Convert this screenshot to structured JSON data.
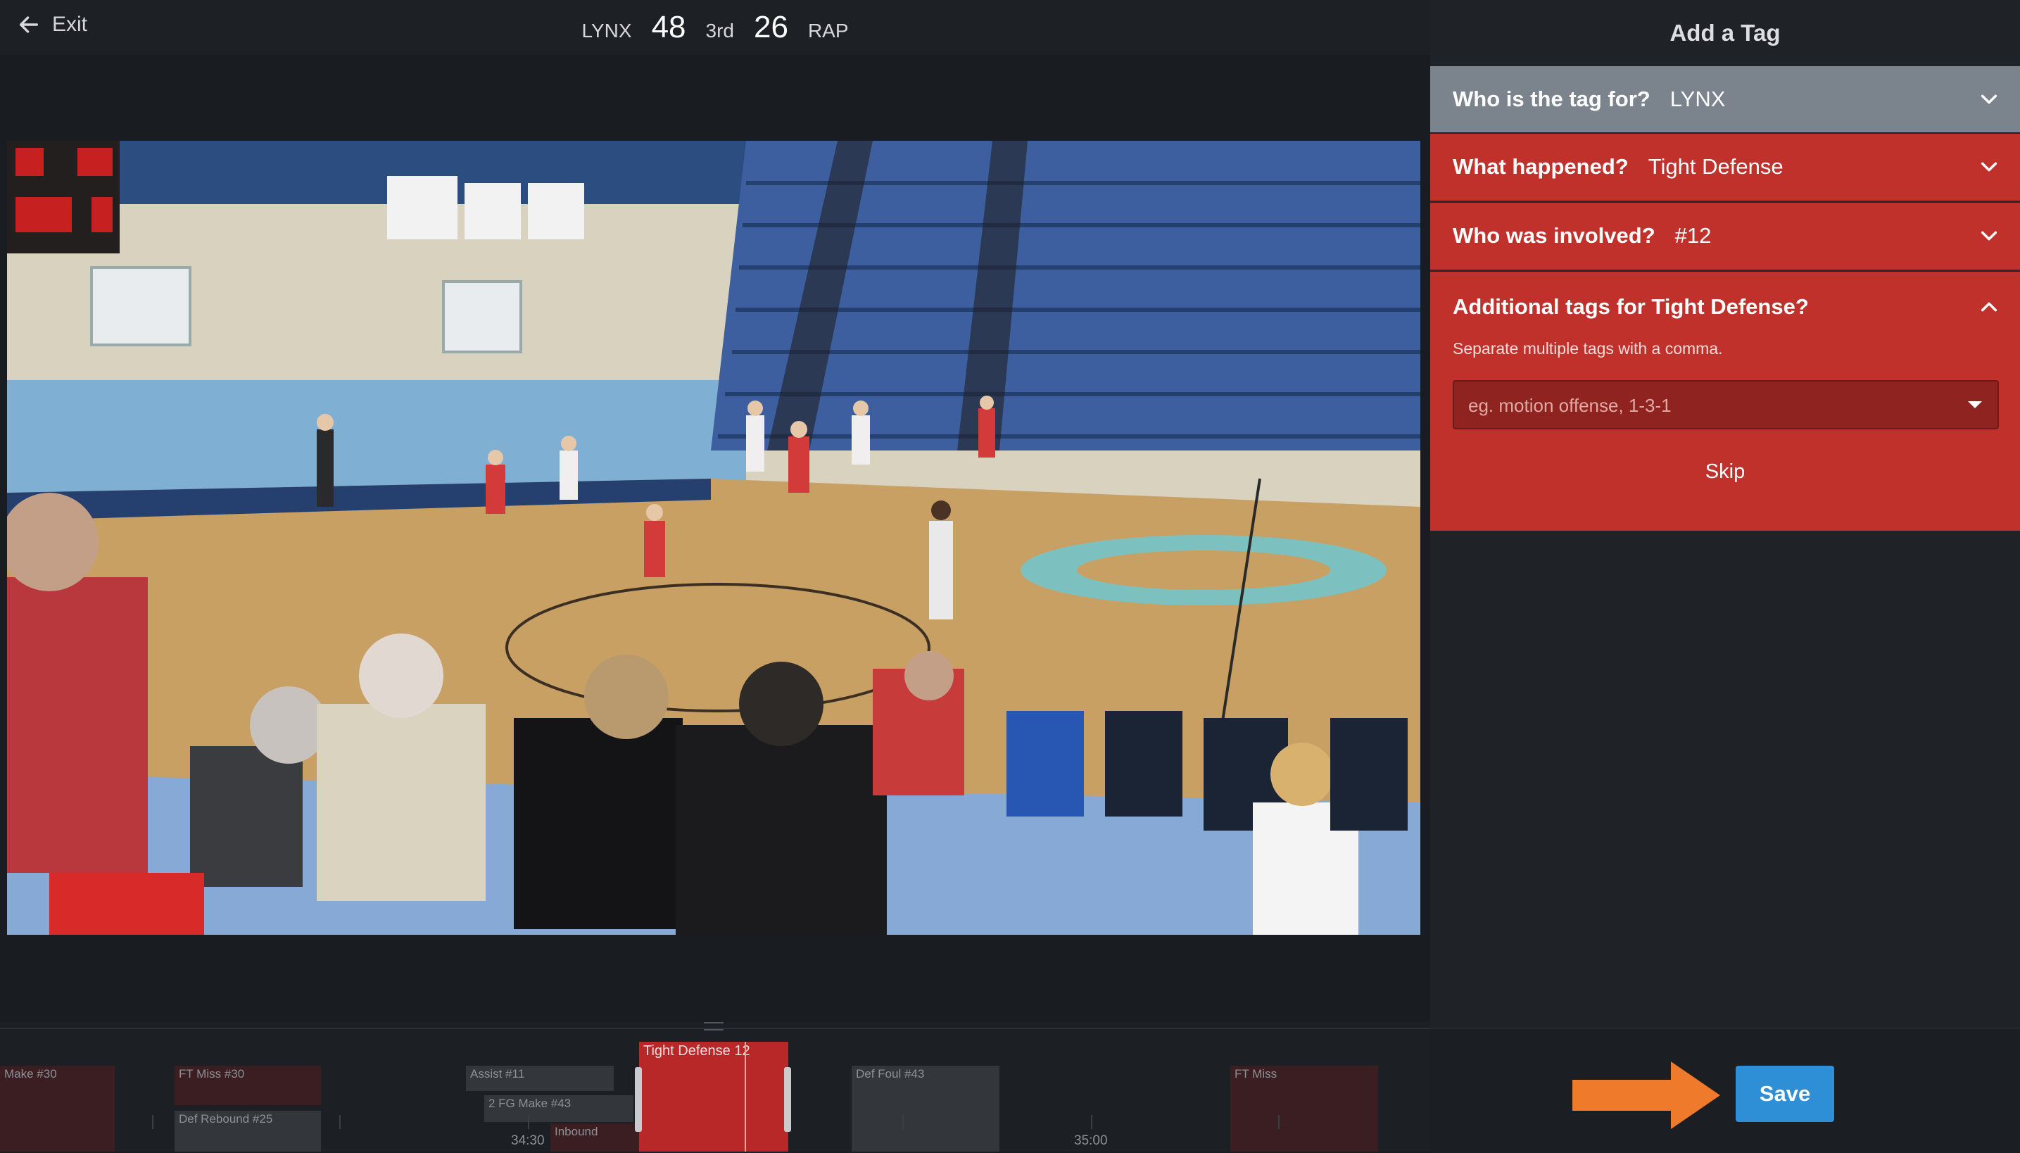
{
  "topbar": {
    "exit_label": "Exit",
    "home_team": "LYNX",
    "home_score": "48",
    "period": "3rd",
    "away_score": "26",
    "away_team": "RAP"
  },
  "timeline": {
    "clips": [
      {
        "label": "Make #30",
        "kind": "red"
      },
      {
        "label": "FT Miss #30",
        "kind": "red"
      },
      {
        "label": "Def Rebound #25",
        "kind": "grey"
      },
      {
        "label": "Assist #11",
        "kind": "grey"
      },
      {
        "label": "2 FG Make #43",
        "kind": "grey"
      },
      {
        "label": "Inbound",
        "kind": "red"
      },
      {
        "label": "Tight Defense 12",
        "kind": "active"
      },
      {
        "label": "Def Foul #43",
        "kind": "grey"
      },
      {
        "label": "FT Miss",
        "kind": "red"
      }
    ],
    "time_labels": [
      "34:30",
      "35:00"
    ]
  },
  "panel": {
    "title": "Add a Tag",
    "who_question": "Who is the tag for?",
    "who_answer": "LYNX",
    "what_question": "What happened?",
    "what_answer": "Tight Defense",
    "involved_question": "Who was involved?",
    "involved_answer": "#12",
    "additional_question": "Additional tags for Tight Defense?",
    "additional_hint": "Separate multiple tags with a comma.",
    "tags_placeholder": "eg. motion offense, 1-3-1",
    "skip_label": "Skip",
    "save_label": "Save"
  },
  "colors": {
    "panel_red": "#c1312b",
    "panel_grey": "#7b848d",
    "save_blue": "#2f8fd6",
    "arrow_orange": "#ef7a2b",
    "timeline_active": "#b82828"
  },
  "icons": {
    "exit": "arrow-left-icon",
    "row_toggle": "chevron-down-icon",
    "section_toggle": "chevron-up-icon",
    "dropdown": "caret-down-icon",
    "callout": "orange-arrow-icon"
  }
}
